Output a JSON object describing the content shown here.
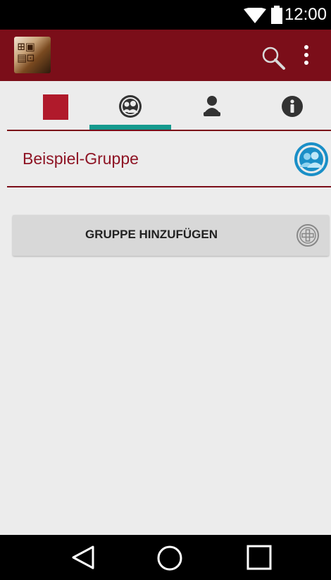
{
  "status_bar": {
    "time": "12:00",
    "icons": [
      "wifi-icon",
      "battery-icon"
    ]
  },
  "app_bar": {
    "logo": "app-logo",
    "actions": [
      "search-icon",
      "more-vert-icon"
    ]
  },
  "tabs": [
    {
      "icon": "color-swatch",
      "color": "#b01a2b",
      "selected": false
    },
    {
      "icon": "group-circle-icon",
      "selected": true
    },
    {
      "icon": "person-icon",
      "selected": false
    },
    {
      "icon": "info-icon",
      "selected": false
    }
  ],
  "group_list": {
    "items": [
      {
        "name": "Beispiel-Gruppe",
        "icon": "group-avatar-icon"
      }
    ]
  },
  "add_group": {
    "label": "GRUPPE HINZUFÜGEN",
    "icon": "add-circle-icon"
  },
  "colors": {
    "primary": "#7b0e19",
    "accent": "#159a8e",
    "group_text": "#8e1424",
    "group_icon": "#1a8fc7",
    "background": "#ececec"
  },
  "nav_bar": {
    "buttons": [
      "back-icon",
      "home-icon",
      "recents-icon"
    ]
  }
}
